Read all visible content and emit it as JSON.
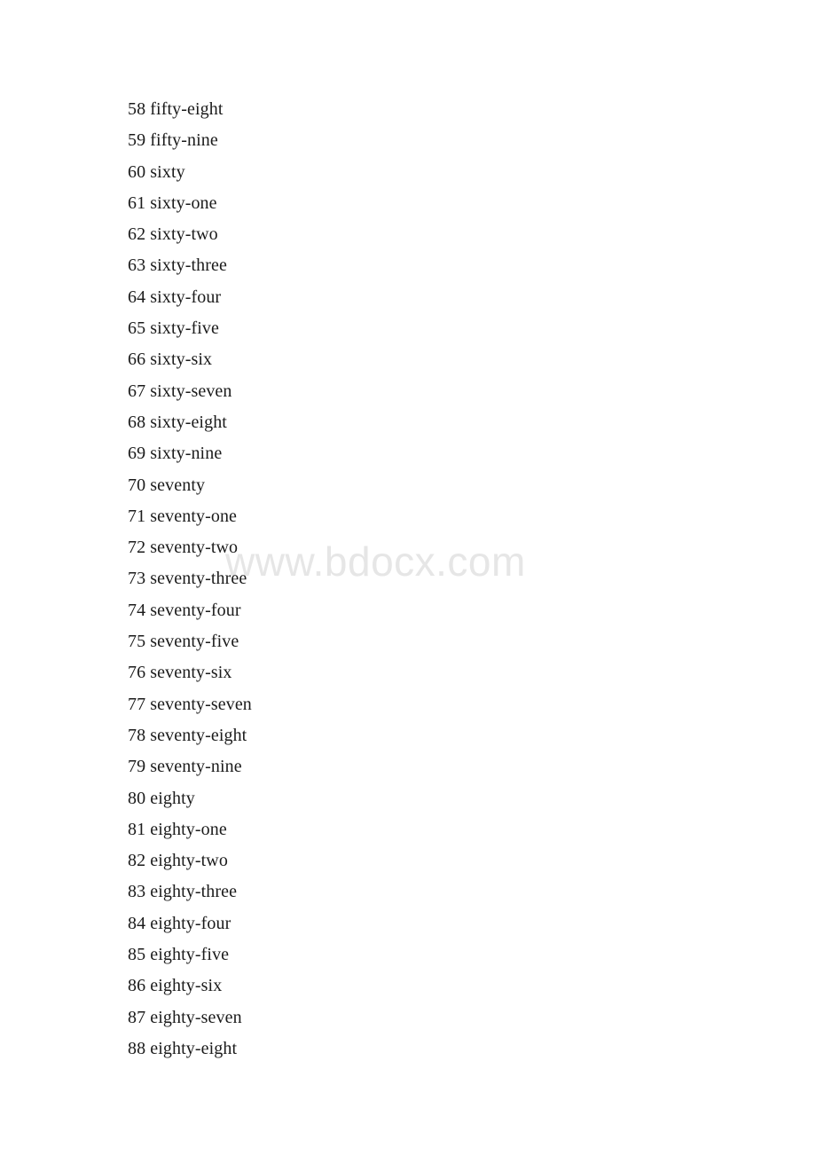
{
  "document": {
    "page_background": "#ffffff",
    "text_color": "#1b1b1b",
    "watermark_color": "#e6e6e6",
    "watermark": "www.bdocx.com"
  },
  "lines": [
    {
      "number": "58",
      "word": "fifty-eight",
      "text": "58 fifty-eight"
    },
    {
      "number": "59",
      "word": "fifty-nine",
      "text": "59 fifty-nine"
    },
    {
      "number": "60",
      "word": "sixty",
      "text": "60 sixty"
    },
    {
      "number": "61",
      "word": "sixty-one",
      "text": "61 sixty-one"
    },
    {
      "number": "62",
      "word": "sixty-two",
      "text": "62 sixty-two"
    },
    {
      "number": "63",
      "word": "sixty-three",
      "text": "63 sixty-three"
    },
    {
      "number": "64",
      "word": "sixty-four",
      "text": "64 sixty-four"
    },
    {
      "number": "65",
      "word": "sixty-five",
      "text": "65 sixty-five"
    },
    {
      "number": "66",
      "word": "sixty-six",
      "text": "66 sixty-six"
    },
    {
      "number": "67",
      "word": "sixty-seven",
      "text": "67 sixty-seven"
    },
    {
      "number": "68",
      "word": "sixty-eight",
      "text": "68 sixty-eight"
    },
    {
      "number": "69",
      "word": "sixty-nine",
      "text": "69 sixty-nine"
    },
    {
      "number": "70",
      "word": "seventy",
      "text": "70 seventy"
    },
    {
      "number": "71",
      "word": "seventy-one",
      "text": "71 seventy-one"
    },
    {
      "number": "72",
      "word": "seventy-two",
      "text": "72 seventy-two"
    },
    {
      "number": "73",
      "word": "seventy-three",
      "text": "73 seventy-three"
    },
    {
      "number": "74",
      "word": "seventy-four",
      "text": "74 seventy-four"
    },
    {
      "number": "75",
      "word": "seventy-five",
      "text": "75 seventy-five"
    },
    {
      "number": "76",
      "word": "seventy-six",
      "text": "76 seventy-six"
    },
    {
      "number": "77",
      "word": "seventy-seven",
      "text": "77 seventy-seven"
    },
    {
      "number": "78",
      "word": "seventy-eight",
      "text": "78 seventy-eight"
    },
    {
      "number": "79",
      "word": "seventy-nine",
      "text": "79 seventy-nine"
    },
    {
      "number": "80",
      "word": "eighty",
      "text": "80 eighty"
    },
    {
      "number": "81",
      "word": "eighty-one",
      "text": "81 eighty-one"
    },
    {
      "number": "82",
      "word": "eighty-two",
      "text": "82 eighty-two"
    },
    {
      "number": "83",
      "word": "eighty-three",
      "text": "83 eighty-three"
    },
    {
      "number": "84",
      "word": "eighty-four",
      "text": "84 eighty-four"
    },
    {
      "number": "85",
      "word": "eighty-five",
      "text": "85 eighty-five"
    },
    {
      "number": "86",
      "word": "eighty-six",
      "text": "86 eighty-six"
    },
    {
      "number": "87",
      "word": "eighty-seven",
      "text": "87 eighty-seven"
    },
    {
      "number": "88",
      "word": "eighty-eight",
      "text": "88 eighty-eight"
    }
  ]
}
